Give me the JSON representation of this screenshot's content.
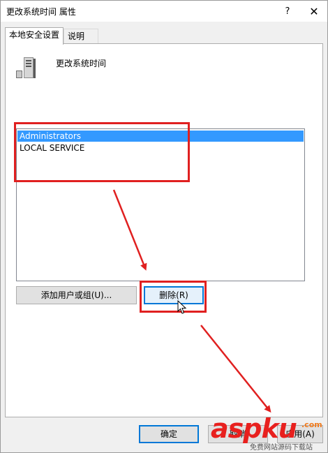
{
  "window": {
    "title": "更改系统时间 属性",
    "help_glyph": "?",
    "close_glyph": "✕"
  },
  "tabs": [
    {
      "label": "本地安全设置",
      "active": true
    },
    {
      "label": "说明",
      "active": false
    }
  ],
  "policy": {
    "icon": "server-policy-icon",
    "name": "更改系统时间"
  },
  "principals": {
    "items": [
      {
        "label": "Administrators",
        "selected": true
      },
      {
        "label": "LOCAL SERVICE",
        "selected": false
      }
    ]
  },
  "actions": {
    "add_label": "添加用户或组(U)...",
    "remove_label": "删除(R)"
  },
  "footer": {
    "ok_label": "确定",
    "cancel_label": "取消",
    "apply_label": "应用(A)"
  },
  "watermark": {
    "brand": "aspku",
    "ribbon": ".com",
    "sub": "免费网站源码下载站"
  },
  "colors": {
    "selection": "#3399ff",
    "annotation": "#e02020",
    "focus_border": "#0078d7",
    "watermark": "#e8201e"
  }
}
